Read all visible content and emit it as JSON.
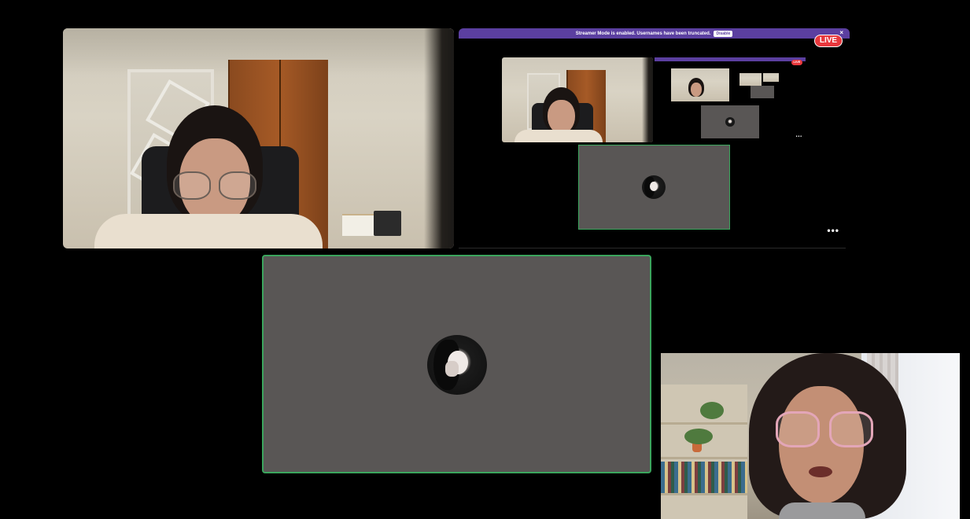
{
  "call": {
    "participants": [
      {
        "role": "webcam",
        "id": "participant-1"
      },
      {
        "role": "screen-share",
        "id": "participant-share"
      },
      {
        "role": "avatar-speaking",
        "id": "participant-2"
      },
      {
        "role": "webcam",
        "id": "participant-3"
      }
    ]
  },
  "screen_share": {
    "streamer_bar_text": "Streamer Mode is enabled. Usernames have been truncated.",
    "disable_label": "Disable",
    "close_symbol": "×",
    "live_label": "LIVE",
    "more_label": "•••",
    "nested": {
      "live_label": "LIVE",
      "more_label": "•••"
    }
  },
  "colors": {
    "background": "#000000",
    "streamer_bar": "#5b3fa0",
    "live_badge": "#e8383d",
    "speaking_ring": "#3ba55d",
    "avatar_tile": "#595655"
  },
  "icons": {
    "close": "close-icon",
    "more": "more-options-icon"
  }
}
